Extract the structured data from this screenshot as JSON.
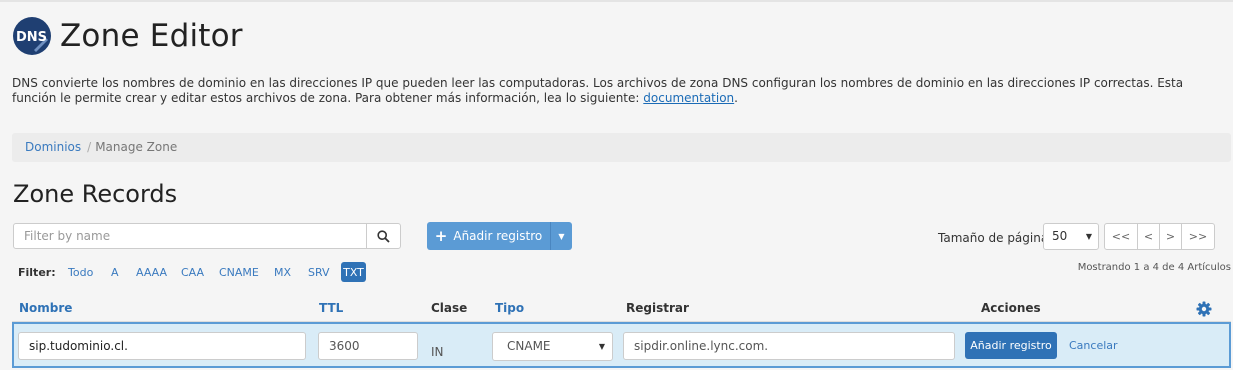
{
  "app": {
    "logo_text": "DNS",
    "title": "Zone Editor",
    "description": "DNS convierte los nombres de dominio en las direcciones IP que pueden leer las computadoras. Los archivos de zona DNS configuran los nombres de dominio en las direcciones IP correctas. Esta función le permite crear y editar estos archivos de zona. Para obtener más información, lea lo siguiente:",
    "description_link": "documentation",
    "description_end": "."
  },
  "breadcrumb": {
    "parent": "Dominios",
    "separator": "/",
    "current": "Manage Zone"
  },
  "section_title": "Zone Records",
  "search": {
    "placeholder": "Filter by name"
  },
  "add_button": {
    "label": "Añadir registro"
  },
  "pagination": {
    "page_size_label": "Tamaño de página",
    "page_size_value": "50",
    "first": "<<",
    "prev": "<",
    "next": ">",
    "last": ">>",
    "showing": "Mostrando 1 a 4 de 4 Artículos"
  },
  "filter": {
    "label": "Filter:",
    "options": [
      "Todo",
      "A",
      "AAAA",
      "CAA",
      "CNAME",
      "MX",
      "SRV",
      "TXT"
    ],
    "active": "TXT"
  },
  "table": {
    "headers": {
      "name": "Nombre",
      "ttl": "TTL",
      "class": "Clase",
      "type": "Tipo",
      "record": "Registrar",
      "actions": "Acciones"
    }
  },
  "edit_row": {
    "name_value": "sip.tudominio.cl.",
    "ttl_value": "3600",
    "class_value": "IN",
    "type_value": "CNAME",
    "record_value": "sipdir.online.lync.com.",
    "save_label": "Añadir registro",
    "cancel_label": "Cancelar"
  },
  "colors": {
    "accent": "#2f72b6",
    "link": "#3a7abf",
    "button": "#5b9bd5",
    "row_highlight": "#d9ecf7"
  },
  "icons": {
    "logo": "dns-icon",
    "search": "search-icon",
    "gear": "gear-icon",
    "caret": "caret-down-icon",
    "plus": "plus-icon"
  }
}
